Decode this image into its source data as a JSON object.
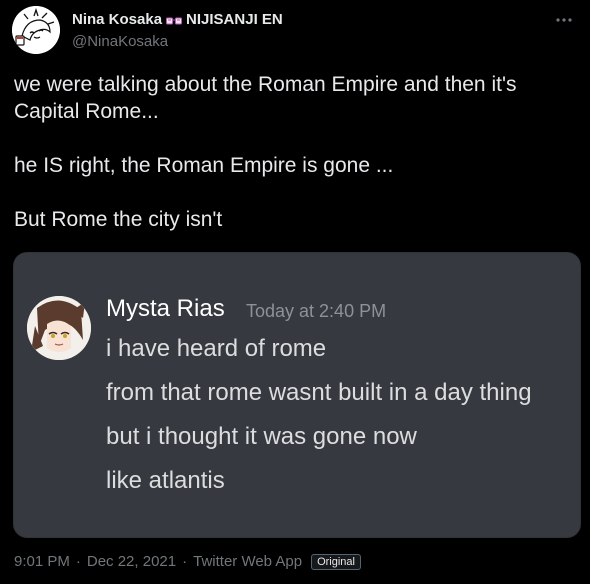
{
  "author": {
    "display_name": "Nina Kosaka",
    "badge_icon": "glasses-emoji-icon",
    "affiliation": "NIJISANJI EN",
    "handle": "@NinaKosaka"
  },
  "tweet": {
    "paragraphs": [
      "we were talking about the Roman Empire and then it's Capital Rome...",
      "he IS right, the Roman Empire is gone ...",
      "But Rome the city isn't"
    ]
  },
  "embedded_image": {
    "username": "Mysta Rias",
    "timestamp": "Today at 2:40 PM",
    "messages": [
      "i have heard of rome",
      "from that rome wasnt built in a day thing",
      "but i thought it was gone now",
      "like atlantis"
    ]
  },
  "meta": {
    "time": "9:01 PM",
    "date": "Dec 22, 2021",
    "source": "Twitter Web App",
    "separator": "·",
    "badge": "Original"
  },
  "colors": {
    "background": "#000000",
    "primary_text": "#e7e9ea",
    "secondary_text": "#71767b",
    "discord_bg": "#36393f",
    "discord_time": "#8e9297"
  }
}
